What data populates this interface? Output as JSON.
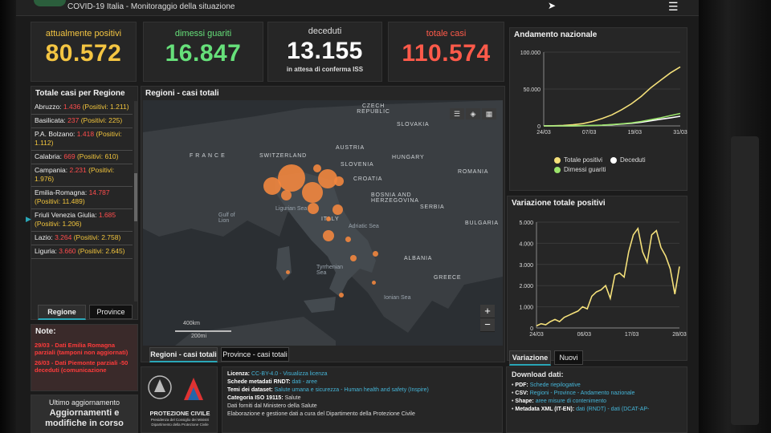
{
  "header": {
    "title": "COVID-19 Italia - Monitoraggio della situazione"
  },
  "kpis": {
    "positivi": {
      "label": "attualmente positivi",
      "value": "80.572",
      "color": "#f4c542"
    },
    "guariti": {
      "label": "dimessi guariti",
      "value": "16.847",
      "color": "#66e07a"
    },
    "deceduti": {
      "label": "deceduti",
      "value": "13.155",
      "sub": "in attesa di conferma ISS",
      "color": "#ffffff"
    },
    "totale": {
      "label": "totale casi",
      "value": "110.574",
      "color": "#ff5a4a"
    }
  },
  "regions_panel": {
    "title": "Totale casi per Regione",
    "items": [
      {
        "name": "Abruzzo:",
        "cases": "1.436",
        "positivi": "(Positivi: 1.211)"
      },
      {
        "name": "Basilicata:",
        "cases": "237",
        "positivi": "(Positivi: 225)"
      },
      {
        "name": "P.A. Bolzano:",
        "cases": "1.418",
        "positivi": "(Positivi: 1.112)"
      },
      {
        "name": "Calabria:",
        "cases": "669",
        "positivi": "(Positivi: 610)"
      },
      {
        "name": "Campania:",
        "cases": "2.231",
        "positivi": "(Positivi: 1.976)"
      },
      {
        "name": "Emilia-Romagna:",
        "cases": "14.787",
        "positivi": "(Positivi: 11.489)"
      },
      {
        "name": "Friuli Venezia Giulia:",
        "cases": "1.685",
        "positivi": "(Positivi: 1.206)"
      },
      {
        "name": "Lazio:",
        "cases": "3.264",
        "positivi": "(Positivi: 2.758)"
      },
      {
        "name": "Liguria:",
        "cases": "3.660",
        "positivi": "(Positivi: 2.645)"
      }
    ],
    "tabs": {
      "regione": "Regione",
      "province": "Province"
    }
  },
  "notes": {
    "title": "Note:",
    "line1": "29/03 - Dati Emilia Romagna parziali (tamponi non aggiornati)",
    "line2": "26/03 - Dati Piemonte parziali -50 deceduti (comunicazione"
  },
  "update": {
    "title": "Ultimo aggiornamento",
    "text": "Aggiornamenti e modifiche in corso"
  },
  "map": {
    "title": "Regioni - casi totali",
    "countries": [
      "FRANCE",
      "SWITZERLAND",
      "AUSTRIA",
      "CZECH REPUBLIC",
      "SLOVAKIA",
      "HUNGARY",
      "ROMANIA",
      "SLOVENIA",
      "CROATIA",
      "BOSNIA AND HERZEGOVINA",
      "SERBIA",
      "BULGARIA",
      "ITALY",
      "ALBANIA",
      "GREECE"
    ],
    "seas": [
      "Gulf of Lion",
      "Ligurian Sea",
      "Adriatic Sea",
      "Tyrrhenian Sea",
      "Ionian Sea"
    ],
    "scale": [
      "400km",
      "200mi"
    ],
    "tabs": {
      "regioni": "Regioni - casi totali",
      "province": "Province - casi totali"
    },
    "zoom_in": "+",
    "zoom_out": "−"
  },
  "chart1": {
    "title": "Andamento nazionale",
    "chart_data": {
      "type": "line",
      "title": "Andamento nazionale",
      "x": [
        "24/03",
        "07/03",
        "19/03",
        "31/03"
      ],
      "yticks": [
        "0",
        "50.000",
        "100.000"
      ],
      "ylim": [
        0,
        100000
      ],
      "series": [
        {
          "name": "Totale positivi",
          "color": "#f4e07a",
          "values": [
            0,
            200,
            600,
            1500,
            3000,
            6000,
            10000,
            15000,
            22000,
            30000,
            40000,
            52000,
            62000,
            72000,
            80000
          ]
        },
        {
          "name": "Deceduti",
          "color": "#ffffff",
          "values": [
            0,
            0,
            0,
            100,
            200,
            500,
            900,
            1500,
            2500,
            3500,
            5000,
            7000,
            9000,
            11000,
            13000
          ]
        },
        {
          "name": "Dimessi guariti",
          "color": "#9be36b",
          "values": [
            0,
            0,
            50,
            100,
            300,
            600,
            1000,
            1800,
            2800,
            4000,
            6000,
            8500,
            11000,
            14000,
            16800
          ]
        }
      ]
    },
    "legend": [
      "Totale positivi",
      "Deceduti",
      "Dimessi guariti"
    ]
  },
  "chart2": {
    "title": "Variazione totale positivi",
    "chart_data": {
      "type": "line",
      "title": "Variazione totale positivi",
      "x": [
        "24/03",
        "06/03",
        "17/03",
        "28/03"
      ],
      "yticks": [
        "0",
        "1.000",
        "2.000",
        "3.000",
        "4.000",
        "5.000"
      ],
      "ylim": [
        0,
        5000
      ],
      "series": [
        {
          "name": "Variazione totale positivi",
          "color": "#f4e07a",
          "values": [
            100,
            200,
            150,
            300,
            400,
            300,
            500,
            600,
            700,
            800,
            1000,
            900,
            1500,
            1700,
            1800,
            2000,
            1400,
            2500,
            2600,
            2400,
            3600,
            4400,
            4700,
            3600,
            3100,
            4400,
            4600,
            3800,
            3400,
            2800,
            1600,
            2900
          ]
        }
      ]
    },
    "tabs": {
      "variazione": "Variazione",
      "nuovi": "Nuovi"
    }
  },
  "license": {
    "lines": [
      {
        "label": "Licenza:",
        "text": "CC-BY-4.0 - Visualizza licenza"
      },
      {
        "label": "Schede metadati RNDT:",
        "text": "dati - aree"
      },
      {
        "label": "Temi dei dataset:",
        "text": "Salute umana e sicurezza - Human health and safety (Inspire)"
      },
      {
        "label": "Categoria ISO 19115:",
        "text": "Salute"
      },
      {
        "label": "",
        "text": "Dati forniti dal Ministero della Salute"
      },
      {
        "label": "",
        "text": "Elaborazione e gestione dati a cura del Dipartimento della Protezione Civile"
      }
    ]
  },
  "protezione": {
    "name": "PROTEZIONE CIVILE",
    "sub1": "Presidenza del Consiglio dei Ministri",
    "sub2": "Dipartimento della Protezione Civile"
  },
  "download": {
    "title": "Download dati:",
    "items": [
      {
        "label": "PDF:",
        "text": "Schede riepilogative"
      },
      {
        "label": "CSV:",
        "text": "Regioni - Province - Andamento nazionale"
      },
      {
        "label": "Shape:",
        "text": "aree misure di contenimento"
      },
      {
        "label": "Metadata XML (IT-EN):",
        "text": "dati (RNDT) - dati (DCAT-AP-"
      }
    ]
  }
}
